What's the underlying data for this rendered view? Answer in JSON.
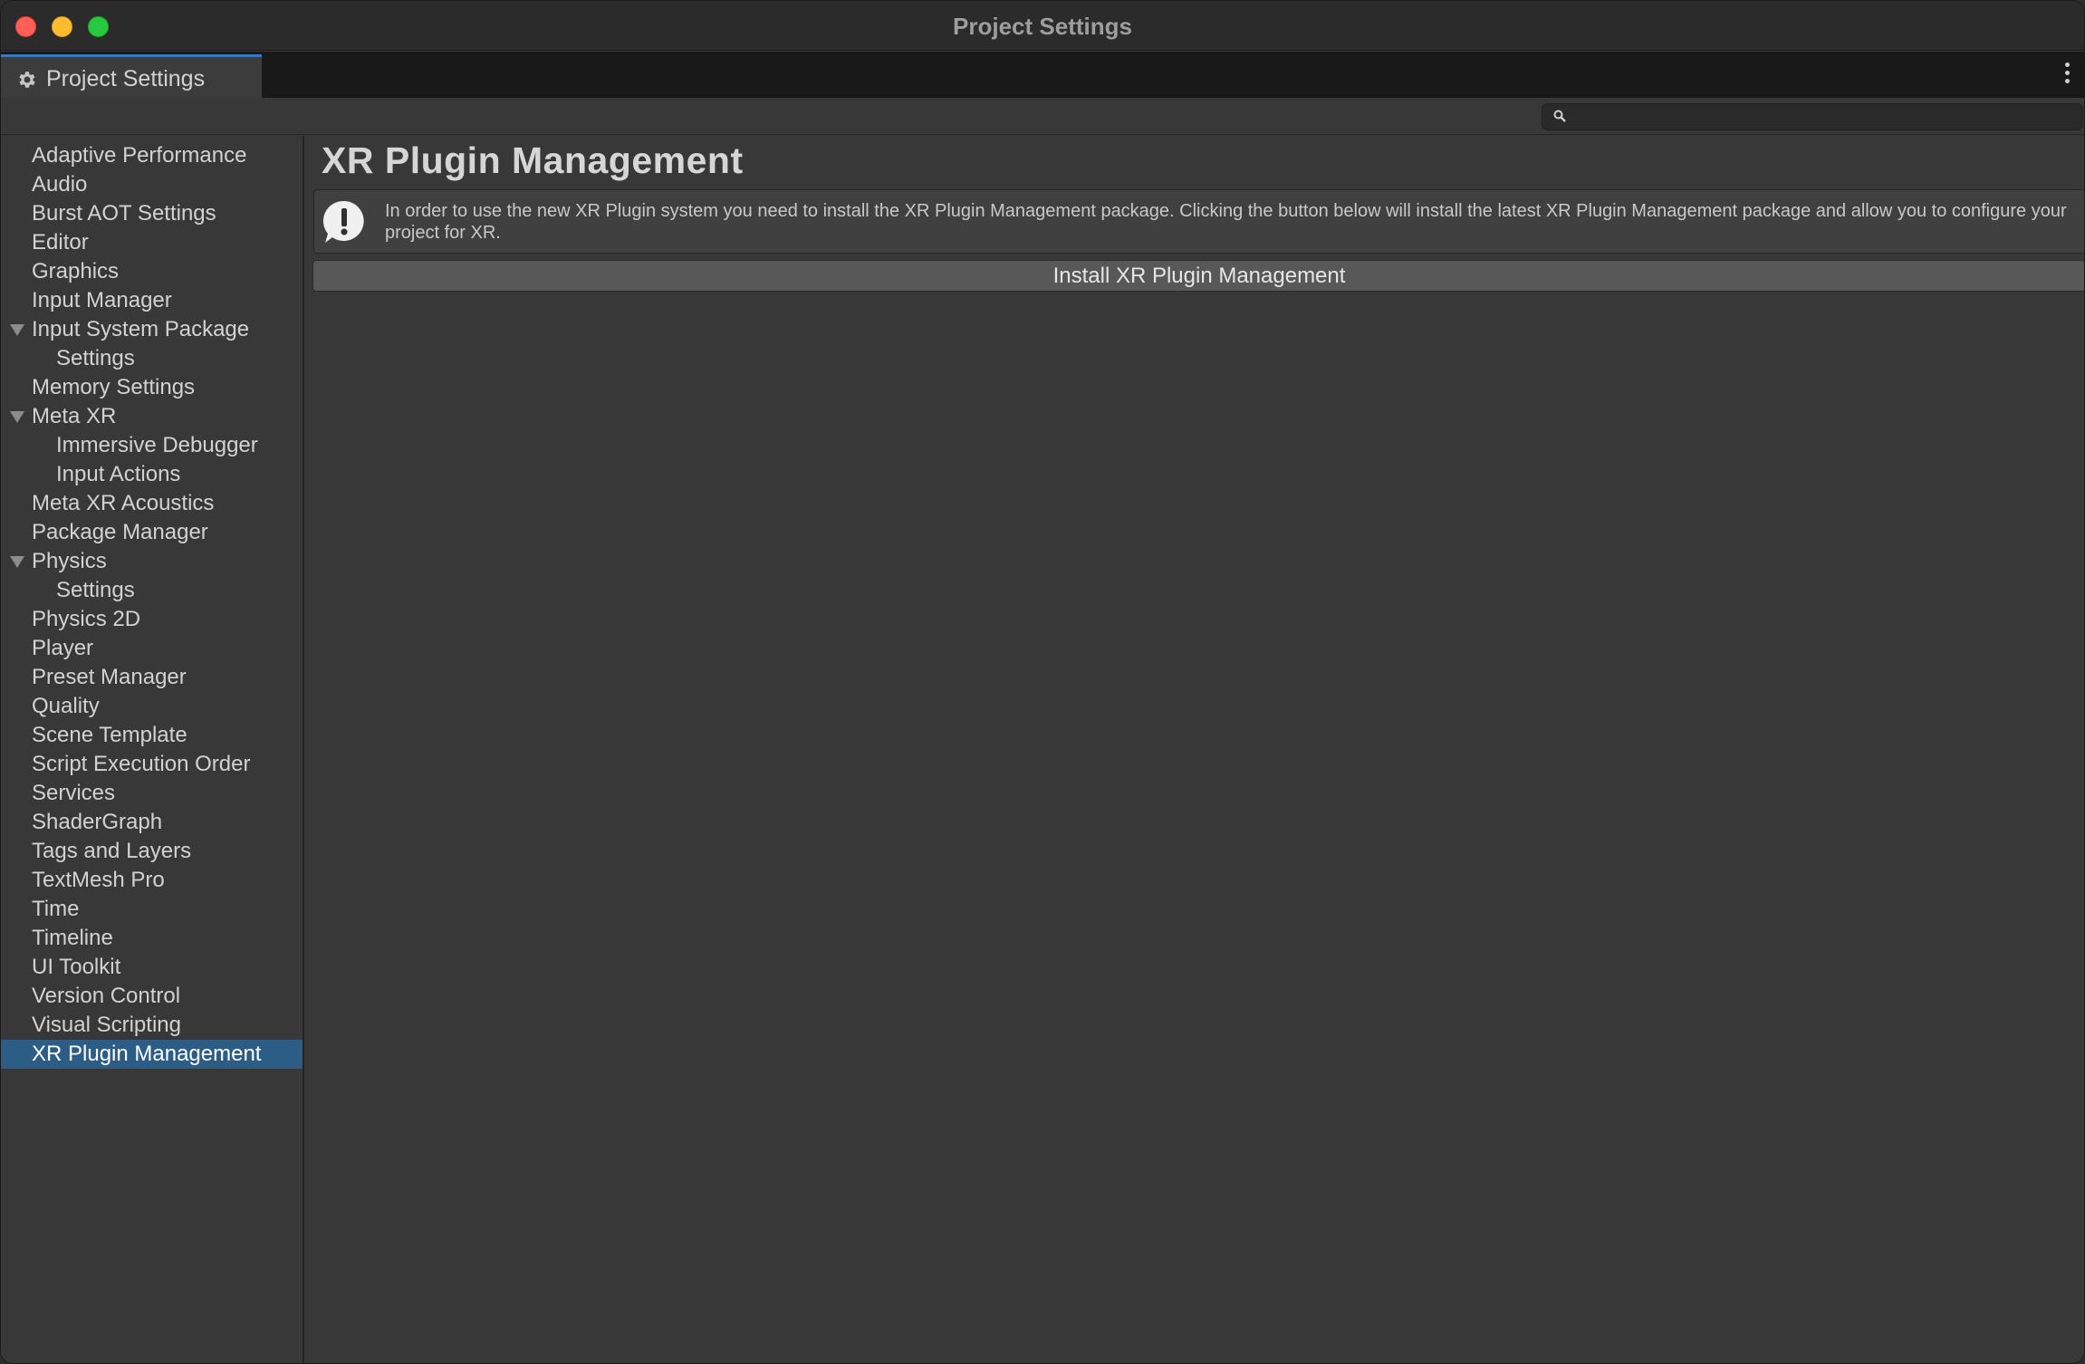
{
  "window": {
    "title": "Project Settings"
  },
  "tab": {
    "label": "Project Settings",
    "icon": "gear-icon"
  },
  "search": {
    "value": "",
    "placeholder": ""
  },
  "sidebar": {
    "items": [
      {
        "label": "Adaptive Performance",
        "indent": 0
      },
      {
        "label": "Audio",
        "indent": 0
      },
      {
        "label": "Burst AOT Settings",
        "indent": 0
      },
      {
        "label": "Editor",
        "indent": 0
      },
      {
        "label": "Graphics",
        "indent": 0
      },
      {
        "label": "Input Manager",
        "indent": 0
      },
      {
        "label": "Input System Package",
        "indent": 0,
        "expanded": true
      },
      {
        "label": "Settings",
        "indent": 1
      },
      {
        "label": "Memory Settings",
        "indent": 0
      },
      {
        "label": "Meta XR",
        "indent": 0,
        "expanded": true
      },
      {
        "label": "Immersive Debugger",
        "indent": 1
      },
      {
        "label": "Input Actions",
        "indent": 1
      },
      {
        "label": "Meta XR Acoustics",
        "indent": 0
      },
      {
        "label": "Package Manager",
        "indent": 0
      },
      {
        "label": "Physics",
        "indent": 0,
        "expanded": true
      },
      {
        "label": "Settings",
        "indent": 1
      },
      {
        "label": "Physics 2D",
        "indent": 0
      },
      {
        "label": "Player",
        "indent": 0
      },
      {
        "label": "Preset Manager",
        "indent": 0
      },
      {
        "label": "Quality",
        "indent": 0
      },
      {
        "label": "Scene Template",
        "indent": 0
      },
      {
        "label": "Script Execution Order",
        "indent": 0
      },
      {
        "label": "Services",
        "indent": 0
      },
      {
        "label": "ShaderGraph",
        "indent": 0
      },
      {
        "label": "Tags and Layers",
        "indent": 0
      },
      {
        "label": "TextMesh Pro",
        "indent": 0
      },
      {
        "label": "Time",
        "indent": 0
      },
      {
        "label": "Timeline",
        "indent": 0
      },
      {
        "label": "UI Toolkit",
        "indent": 0
      },
      {
        "label": "Version Control",
        "indent": 0
      },
      {
        "label": "Visual Scripting",
        "indent": 0
      },
      {
        "label": "XR Plugin Management",
        "indent": 0,
        "selected": true
      }
    ]
  },
  "main": {
    "title": "XR Plugin Management",
    "help_text": "In order to use the new XR Plugin system you need to install the XR Plugin Management package. Clicking the button below will install the latest XR Plugin Management package and allow you to configure your project for XR.",
    "install_button": "Install XR Plugin Management"
  },
  "colors": {
    "selection": "#2c5d87",
    "tab_accent": "#3a79bb",
    "background": "#383838"
  }
}
